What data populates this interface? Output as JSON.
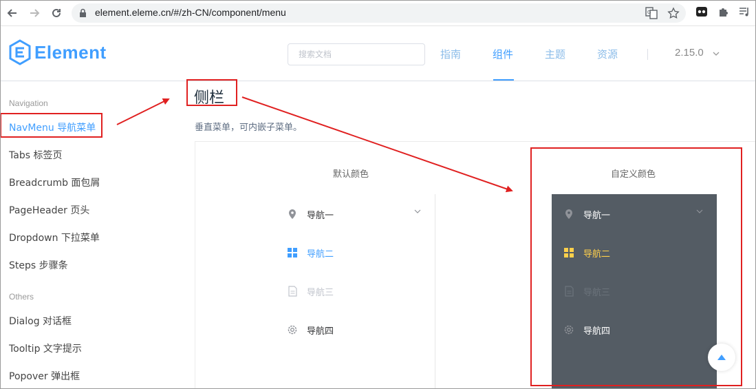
{
  "browser": {
    "url": "element.eleme.cn/#/zh-CN/component/menu"
  },
  "header": {
    "logo_text": "Element",
    "search_placeholder": "搜索文档",
    "nav": [
      "指南",
      "组件",
      "主题",
      "资源"
    ],
    "active_nav": "组件",
    "version": "2.15.0"
  },
  "sidebar": {
    "group_navigation": "Navigation",
    "navigation_items": [
      "NavMenu 导航菜单",
      "Tabs 标签页",
      "Breadcrumb 面包屑",
      "PageHeader 页头",
      "Dropdown 下拉菜单",
      "Steps 步骤条"
    ],
    "group_others": "Others",
    "others_items": [
      "Dialog 对话框",
      "Tooltip 文字提示",
      "Popover 弹出框"
    ]
  },
  "content": {
    "section_title": "侧栏",
    "description": "垂直菜单，可内嵌子菜单。",
    "default_color_title": "默认颜色",
    "custom_color_title": "自定义颜色",
    "menu_items": [
      "导航一",
      "导航二",
      "导航三",
      "导航四"
    ]
  },
  "colors": {
    "primary": "#409eff",
    "dark_menu_bg": "#545c64",
    "dark_active": "#ffd04b",
    "annotation_red": "#e02020"
  }
}
